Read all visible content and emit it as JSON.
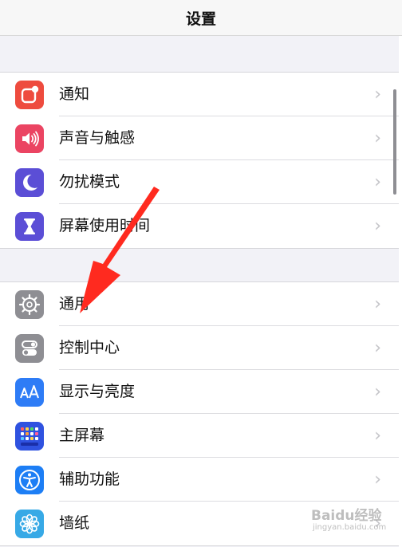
{
  "nav": {
    "title": "设置"
  },
  "group1": [
    {
      "label": "通知",
      "icon": "notifications-icon",
      "color": "#ee4b3e"
    },
    {
      "label": "声音与触感",
      "icon": "speaker-icon",
      "color": "#eb4462"
    },
    {
      "label": "勿扰模式",
      "icon": "moon-icon",
      "color": "#5b4ed6"
    },
    {
      "label": "屏幕使用时间",
      "icon": "hourglass-icon",
      "color": "#5b4ed6"
    }
  ],
  "group2": [
    {
      "label": "通用",
      "icon": "gear-icon",
      "color": "#8e8e93"
    },
    {
      "label": "控制中心",
      "icon": "toggles-icon",
      "color": "#8e8e93"
    },
    {
      "label": "显示与亮度",
      "icon": "text-size-icon",
      "color": "#2e7cf6"
    },
    {
      "label": "主屏幕",
      "icon": "home-grid-icon",
      "color": "#2f52e0"
    },
    {
      "label": "辅助功能",
      "icon": "accessibility-icon",
      "color": "#1d7ef5"
    },
    {
      "label": "墙纸",
      "icon": "flower-icon",
      "color": "#37a9e6"
    }
  ],
  "chevron": "›",
  "watermark": {
    "text": "Baidu经验",
    "sub": "jingyan.baidu.com"
  },
  "colors": {
    "background": "#f2f2f7",
    "arrow": "#ff2a1f",
    "separator": "#dcdce0"
  }
}
